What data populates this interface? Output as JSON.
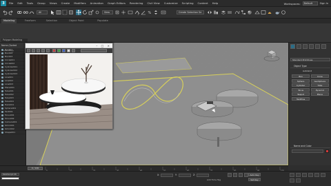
{
  "menubar": {
    "items": [
      "File",
      "Edit",
      "Tools",
      "Group",
      "Views",
      "Create",
      "Modifiers",
      "Animation",
      "Graph Editors",
      "Rendering",
      "Civil View",
      "Customize",
      "Scripting",
      "Content",
      "Help"
    ],
    "workspaces_label": "Workspaces:",
    "workspace_value": "Default",
    "sign_in": "Sign In"
  },
  "toolbar": {
    "selection_filter": "All",
    "view_dropdown": "View",
    "named_selection": "Create Selection Se"
  },
  "ribbon": {
    "tabs": [
      "Modeling",
      "Freeform",
      "Selection",
      "Object Paint",
      "Populate"
    ],
    "active_tab": "Modeling",
    "panel_title": "Polygon Modeling"
  },
  "explorer": {
    "header": "Name (Sorted Ascending)",
    "rows": [
      "Box001",
      "Box002",
      "Box003",
      "Circle001",
      "Circle002",
      "Cylinder001",
      "Cylinder002",
      "Cylinder003",
      "Line001",
      "Line002",
      "Line003",
      "Plane001",
      "Tube001",
      "Tube002",
      "Tube003",
      "Tube004",
      "Helix001",
      "Sphere001",
      "Text001",
      "Torus001",
      "Torus002",
      "Camera001",
      "Omni001",
      "Omni002",
      "Shape001"
    ]
  },
  "viewport": {
    "label": "[+] [Perspective] [Standard] [Default Shading]"
  },
  "image_viewer": {
    "title": "",
    "channel_dropdown": ""
  },
  "command_panel": {
    "category_dropdown": "Standard Primitives",
    "object_type_title": "Object Type",
    "autogrid": "AutoGrid",
    "primitives": [
      "Box",
      "Cone",
      "Sphere",
      "GeoSphere",
      "Cylinder",
      "Tube",
      "Torus",
      "Pyramid",
      "Teapot",
      "Plane",
      "TextPlus"
    ],
    "name_color_title": "Name and Color"
  },
  "timeline": {
    "frame_slider": "0 / 100",
    "ticks": [
      "0",
      "10",
      "20",
      "30",
      "40",
      "50",
      "60",
      "70",
      "80",
      "90",
      "100"
    ]
  },
  "status": {
    "maxscript": "MAXScript Mi",
    "line1": "",
    "line2": "",
    "x_label": "X:",
    "y_label": "Y:",
    "z_label": "Z:",
    "x_val": "",
    "y_val": "",
    "z_val": "",
    "grid": "",
    "add_time_tag": "Add Time Tag",
    "auto_key": "Auto Key",
    "set_key": "Set Key"
  },
  "colors": {
    "accent": "#2a6c86",
    "selection_highlight": "#f0e040",
    "viewport_bg": "#7d7d7d",
    "object_color_swatch": "#d03a3a"
  },
  "icons": [
    "undo-icon",
    "redo-icon",
    "link-icon",
    "unlink-icon",
    "bind-icon",
    "select-icon",
    "move-icon",
    "rotate-icon",
    "scale-icon",
    "snap-icon",
    "mirror-icon",
    "align-icon",
    "render-icon",
    "teapot-icon"
  ]
}
